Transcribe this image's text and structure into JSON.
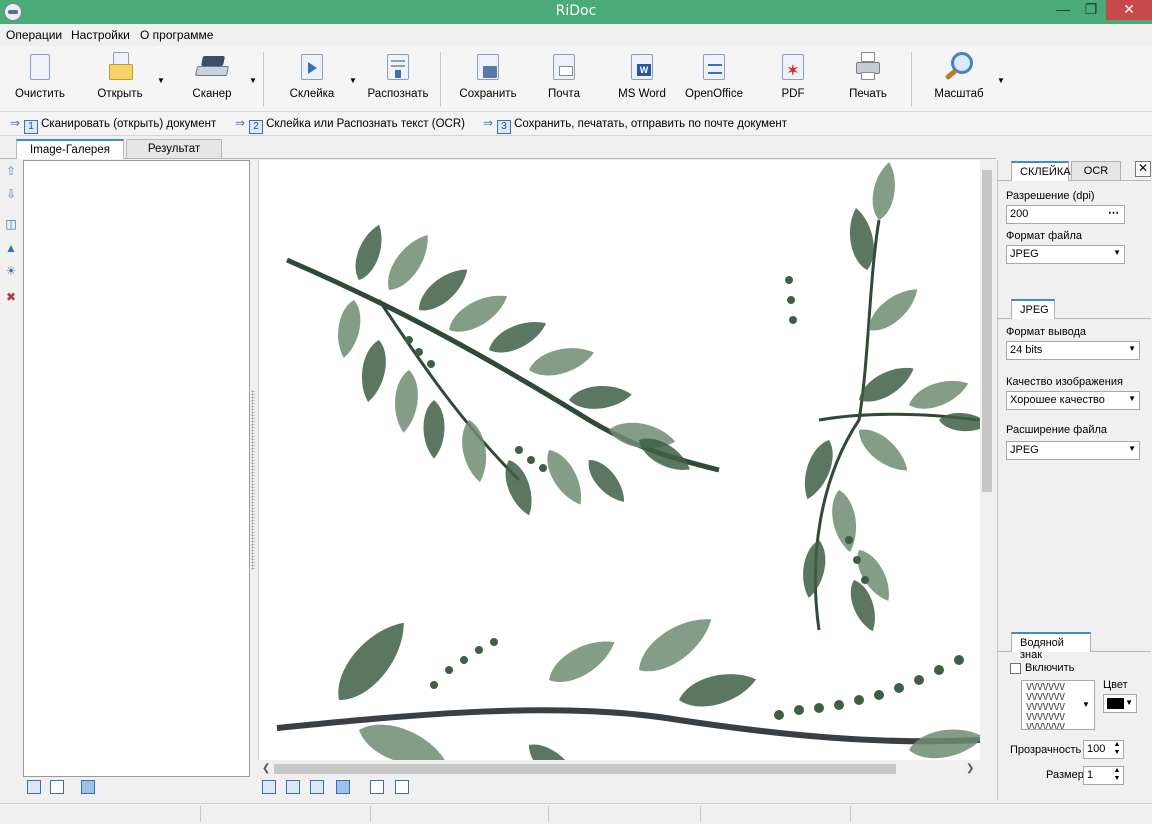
{
  "window": {
    "title": "RiDoc"
  },
  "menu": [
    "Операции",
    "Настройки",
    "О программе"
  ],
  "toolbar": {
    "clear": "Очистить",
    "open": "Открыть",
    "scanner": "Сканер",
    "glue": "Склейка",
    "recognize": "Распознать",
    "save": "Сохранить",
    "mail": "Почта",
    "msword": "MS Word",
    "openoffice": "OpenOffice",
    "pdf": "PDF",
    "print": "Печать",
    "zoom": "Масштаб"
  },
  "steps": [
    {
      "num": "1",
      "text": "Сканировать (открыть) документ"
    },
    {
      "num": "2",
      "text": "Склейка или Распознать текст (OCR)"
    },
    {
      "num": "3",
      "text": "Сохранить, печатать, отправить по почте документ"
    }
  ],
  "tabs": {
    "gallery": "Image-Галерея",
    "result": "Результат"
  },
  "right": {
    "tabs": {
      "glue": "СКЛЕЙКА",
      "ocr": "OCR"
    },
    "resolution_label": "Разрешение (dpi)",
    "resolution_value": "200",
    "file_format_label": "Формат файла",
    "file_format_value": "JPEG",
    "jpeg_tab": "JPEG",
    "output_format_label": "Формат вывода",
    "output_format_value": "24 bits",
    "quality_label": "Качество изображения",
    "quality_value": "Хорошее качество",
    "extension_label": "Расширение файла",
    "extension_value": "JPEG",
    "watermark_tab": "Водяной знак",
    "enable_label": "Включить",
    "color_label": "Цвет",
    "transparency_label": "Прозрачность",
    "transparency_value": "100",
    "size_label": "Размер",
    "size_value": "1",
    "watermark_preview": "VVVVVVV VVVVVVV VVVVVVV VVVVVVV VVVVVVV"
  },
  "colors": {
    "titlebar": "#4aab79",
    "accent": "#3c8bd6",
    "leaf_dark": "#3e5f45",
    "leaf_light": "#6e8c72"
  }
}
